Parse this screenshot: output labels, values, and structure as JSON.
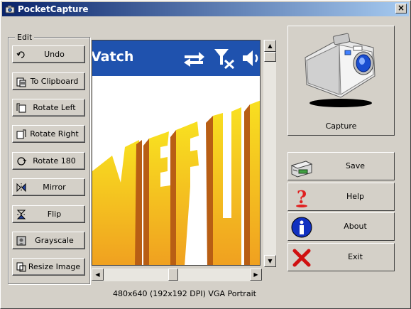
{
  "window": {
    "title": "PocketCapture",
    "close_glyph": "×"
  },
  "edit_group": {
    "label": "Edit",
    "buttons": [
      {
        "label": "Undo",
        "icon": "undo-icon"
      },
      {
        "label": "To Clipboard",
        "icon": "clipboard-icon"
      },
      {
        "label": "Rotate Left",
        "icon": "rotate-left-icon"
      },
      {
        "label": "Rotate Right",
        "icon": "rotate-right-icon"
      },
      {
        "label": "Rotate 180",
        "icon": "rotate-180-icon"
      },
      {
        "label": "Mirror",
        "icon": "mirror-icon"
      },
      {
        "label": "Flip",
        "icon": "flip-icon"
      },
      {
        "label": "Grayscale",
        "icon": "grayscale-icon"
      },
      {
        "label": "Resize Image",
        "icon": "resize-icon"
      }
    ]
  },
  "preview": {
    "title_fragment": "Vatch",
    "image_text": "MEU"
  },
  "status": "480x640 (192x192 DPI) VGA Portrait",
  "capture": {
    "label": "Capture",
    "icon": "camera-icon"
  },
  "actions": [
    {
      "label": "Save",
      "icon": "save-icon"
    },
    {
      "label": "Help",
      "icon": "help-icon"
    },
    {
      "label": "About",
      "icon": "info-icon"
    },
    {
      "label": "Exit",
      "icon": "exit-icon"
    }
  ],
  "colors": {
    "title_gradient_start": "#0a246a",
    "title_gradient_end": "#a6caf0",
    "phone_bar": "#1f52ae",
    "image_orange": "#f0a020",
    "image_yellow": "#f8e020"
  }
}
